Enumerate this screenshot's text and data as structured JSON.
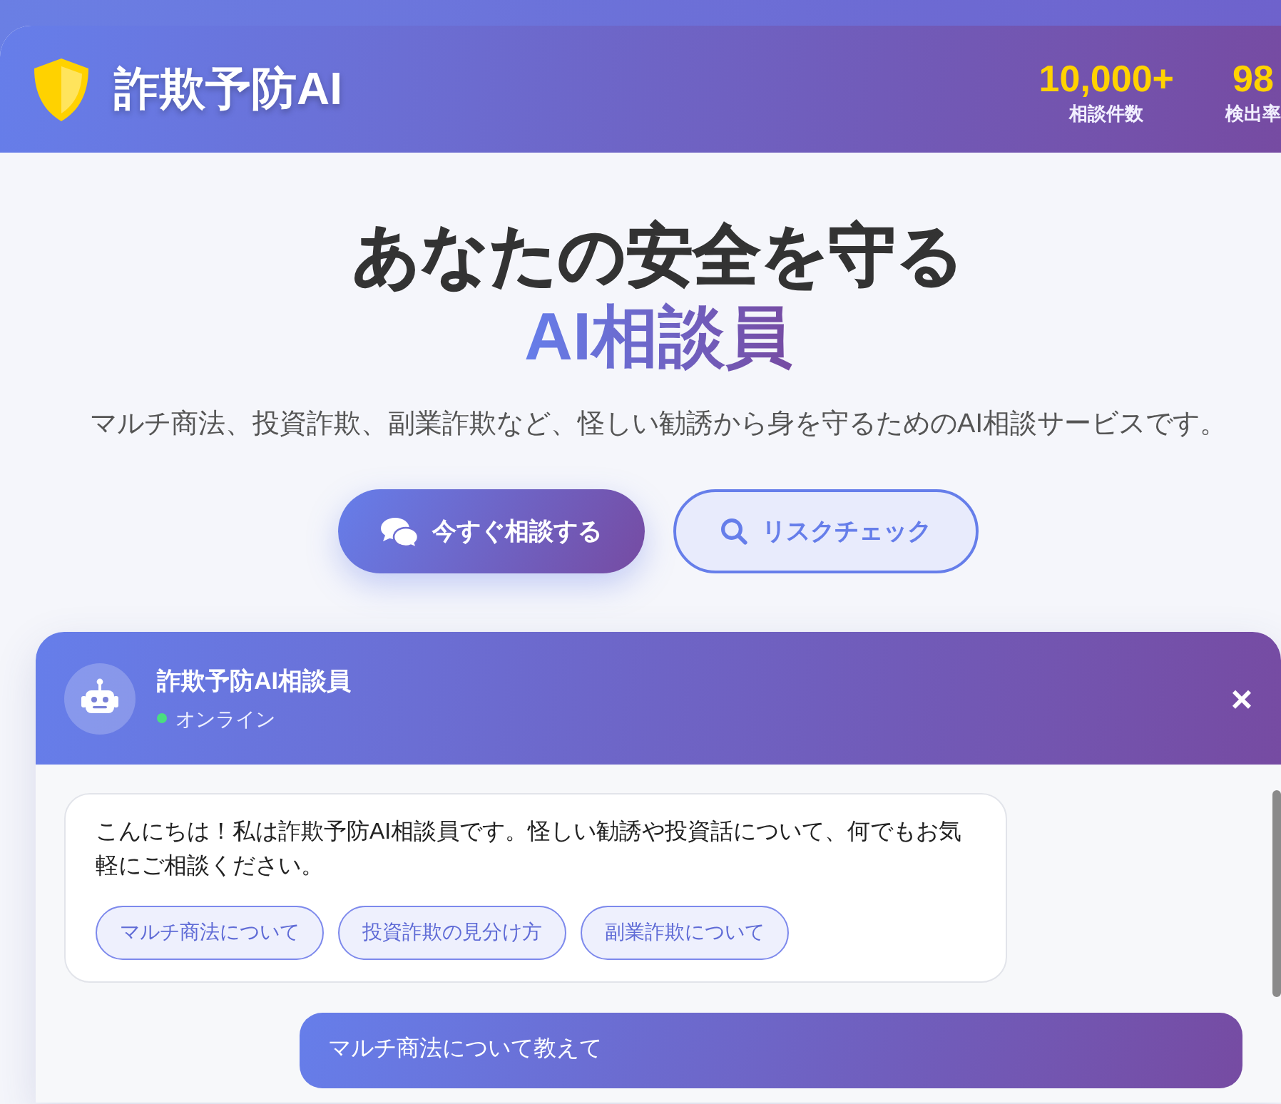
{
  "header": {
    "logo": "詐欺予防AI",
    "stats": [
      {
        "value": "10,000+",
        "label": "相談件数"
      },
      {
        "value": "98",
        "label": "検出率"
      }
    ]
  },
  "hero": {
    "title": "あなたの安全を守る",
    "title_accent": "AI相談員",
    "subtitle": "マルチ商法、投資詐欺、副業詐欺など、怪しい勧誘から身を守るためのAI相談サービスです。",
    "buttons": [
      {
        "kind": "primary",
        "label": "今すぐ相談する"
      },
      {
        "kind": "secondary",
        "label": "リスクチェック"
      }
    ]
  },
  "chat": {
    "title": "詐欺予防AI相談員",
    "status": "オンライン",
    "online": true,
    "close": "×",
    "messages": [
      {
        "kind": "bot",
        "text": "こんにちは！私は詐欺予防AI相談員です。怪しい勧誘や投資話について、何でもお気軽にご相談ください。",
        "quick_replies": [
          "マルチ商法について",
          "投資詐欺の見分け方",
          "副業詐欺について"
        ]
      },
      {
        "kind": "user",
        "text": "マルチ商法について教えて"
      }
    ]
  }
}
